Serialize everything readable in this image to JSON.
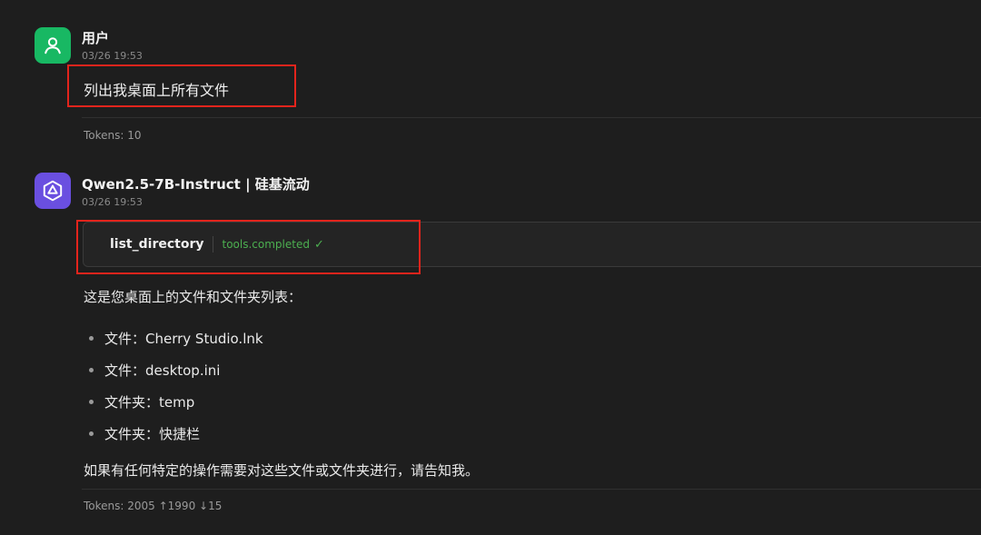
{
  "messages": {
    "user": {
      "name": "用户",
      "time": "03/26 19:53",
      "text": "列出我桌面上所有文件",
      "tokens": "Tokens: 10",
      "avatar_icon": "user-icon",
      "avatar_color": "#18b863"
    },
    "model": {
      "name": "Qwen2.5-7B-Instruct | 硅基流动",
      "time": "03/26 19:53",
      "avatar_icon": "model-logo-icon",
      "avatar_color": "#6a4fe0",
      "tool": {
        "name": "list_directory",
        "status": "tools.completed",
        "status_icon": "check-icon",
        "status_color": "#4caf50"
      },
      "intro": "这是您桌面上的文件和文件夹列表：",
      "items": [
        "文件：Cherry Studio.lnk",
        "文件：desktop.ini",
        "文件夹：temp",
        "文件夹：快捷栏"
      ],
      "outro": "如果有任何特定的操作需要对这些文件或文件夹进行，请告知我。",
      "tokens": "Tokens: 2005 ↑1990 ↓15"
    }
  },
  "highlight_color": "#e3241c"
}
